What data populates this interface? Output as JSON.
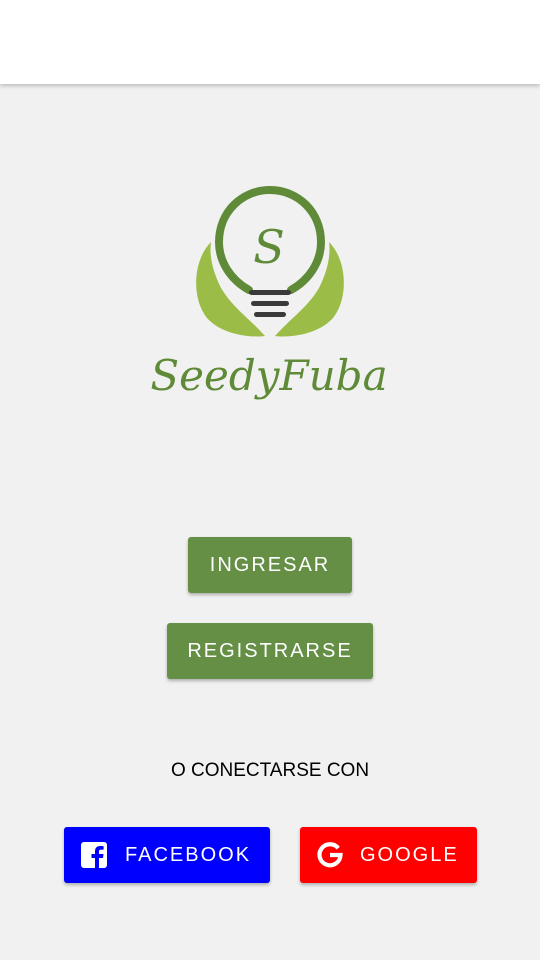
{
  "colors": {
    "primary_green": "#648f45",
    "facebook_blue": "#0000ff",
    "google_red": "#ff0000",
    "logo_dark_green": "#5f8a38",
    "logo_light_green": "#9bbd48",
    "logo_bar": "#3a3a3a",
    "background": "#f1f1f1"
  },
  "logo": {
    "monogram": "S",
    "brand_name": "SeedyFuba"
  },
  "actions": {
    "login_label": "INGRESAR",
    "register_label": "REGISTRARSE"
  },
  "social": {
    "connect_text": "O CONECTARSE CON",
    "facebook_label": "FACEBOOK",
    "facebook_icon": "facebook-icon",
    "google_label": "GOOGLE",
    "google_icon": "google-icon"
  }
}
